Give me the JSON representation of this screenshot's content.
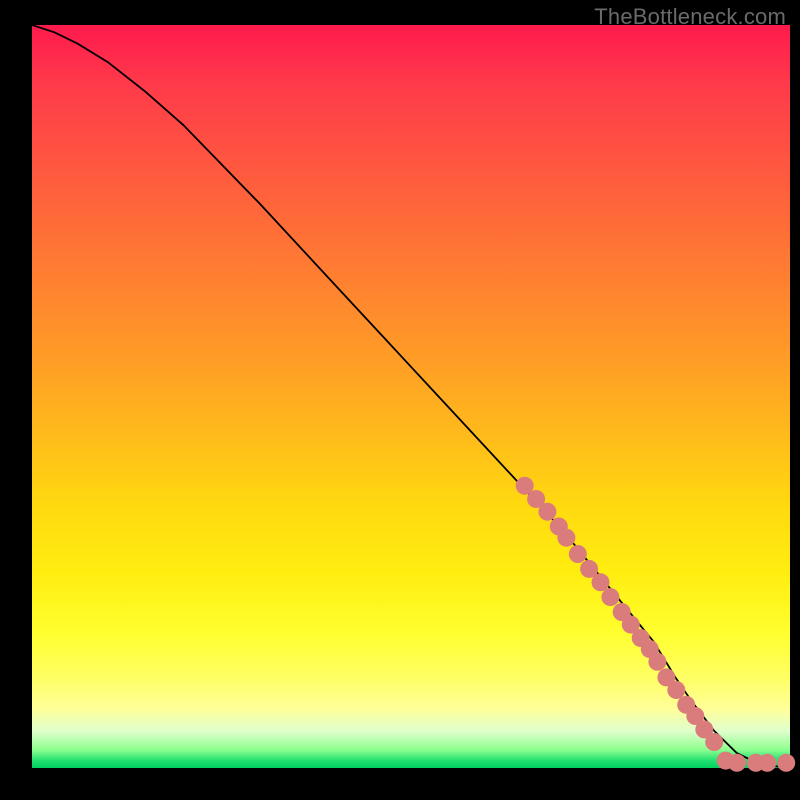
{
  "watermark_text": "TheBottleneck.com",
  "colors": {
    "point": "#db7c7c",
    "curve": "#000000"
  },
  "chart_data": {
    "type": "line",
    "title": "",
    "xlabel": "",
    "ylabel": "",
    "xlim": [
      0,
      100
    ],
    "ylim": [
      0,
      100
    ],
    "series": [
      {
        "name": "main-curve",
        "x": [
          0,
          3,
          6,
          10,
          15,
          20,
          30,
          40,
          50,
          60,
          70,
          78,
          82,
          85,
          87,
          90,
          93,
          96,
          100
        ],
        "values": [
          100,
          99,
          97.5,
          95,
          91,
          86.5,
          76,
          65,
          54,
          43,
          32,
          22,
          17,
          12,
          9,
          5,
          2,
          0.5,
          0
        ]
      }
    ],
    "points": [
      {
        "x": 65.0,
        "y": 38.0
      },
      {
        "x": 66.5,
        "y": 36.2
      },
      {
        "x": 68.0,
        "y": 34.5
      },
      {
        "x": 69.5,
        "y": 32.5
      },
      {
        "x": 70.5,
        "y": 31.0
      },
      {
        "x": 72.0,
        "y": 28.8
      },
      {
        "x": 73.5,
        "y": 26.8
      },
      {
        "x": 75.0,
        "y": 25.0
      },
      {
        "x": 76.3,
        "y": 23.0
      },
      {
        "x": 77.8,
        "y": 21.0
      },
      {
        "x": 79.0,
        "y": 19.3
      },
      {
        "x": 80.3,
        "y": 17.5
      },
      {
        "x": 81.5,
        "y": 16.0
      },
      {
        "x": 82.5,
        "y": 14.3
      },
      {
        "x": 83.7,
        "y": 12.2
      },
      {
        "x": 85.0,
        "y": 10.5
      },
      {
        "x": 86.3,
        "y": 8.5
      },
      {
        "x": 87.5,
        "y": 7.0
      },
      {
        "x": 88.7,
        "y": 5.2
      },
      {
        "x": 90.0,
        "y": 3.5
      },
      {
        "x": 91.5,
        "y": 1.0
      },
      {
        "x": 93.0,
        "y": 0.7
      },
      {
        "x": 95.5,
        "y": 0.7
      },
      {
        "x": 97.0,
        "y": 0.7
      },
      {
        "x": 99.5,
        "y": 0.7
      }
    ]
  }
}
